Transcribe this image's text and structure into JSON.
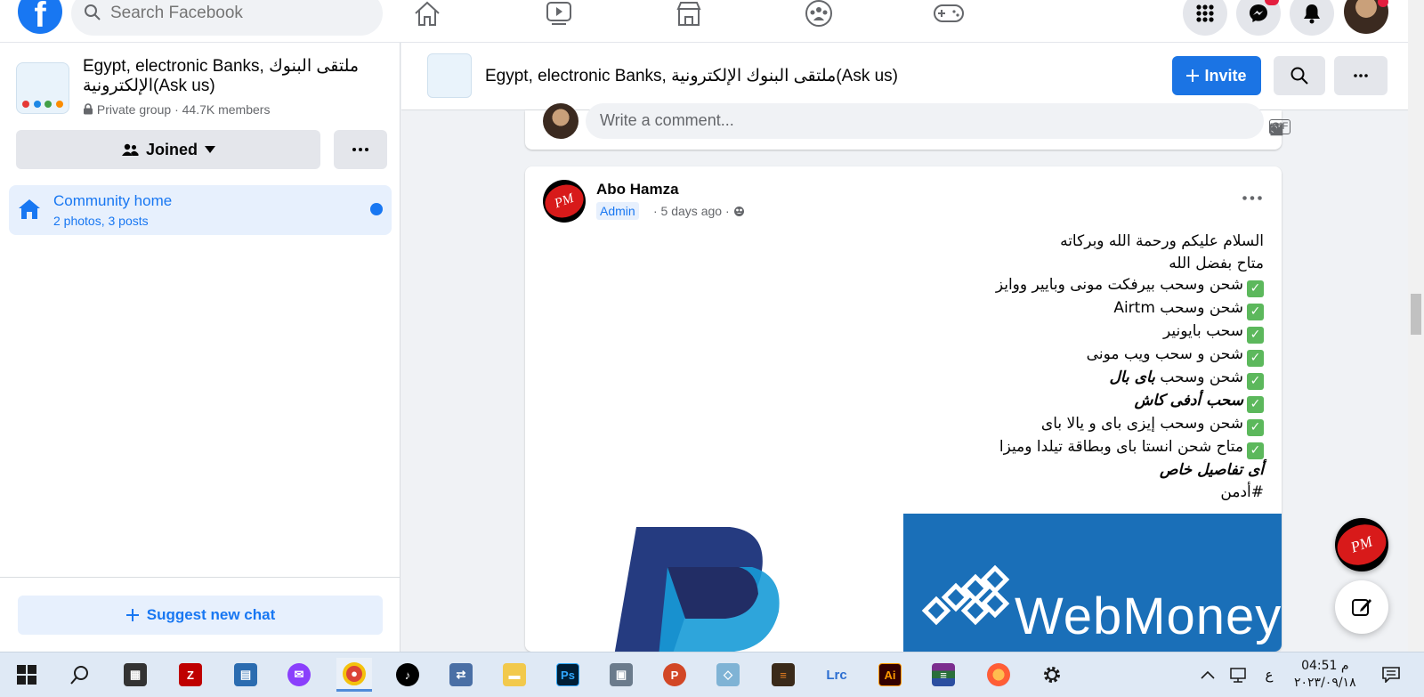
{
  "topbar": {
    "search_placeholder": "Search Facebook",
    "logo_letter": "f"
  },
  "group": {
    "name": "Egypt, electronic Banks, ملتقى البنوك الإلكترونية(Ask us)",
    "privacy": "Private group",
    "members": "44.7K members",
    "joined_label": "Joined",
    "community_home": "Community home",
    "community_sub": "2 photos, 3 posts",
    "suggest_label": "Suggest new chat"
  },
  "header": {
    "title": "Egypt, electronic Banks, ملتقى البنوك الإلكترونية(Ask us)",
    "invite_label": "Invite"
  },
  "comment": {
    "placeholder": "Write a comment..."
  },
  "post": {
    "author": "Abo Hamza",
    "role": "Admin",
    "time": "· 5 days ago ·",
    "logo_text": "PM",
    "lines": [
      "السلام عليكم ورحمة الله وبركاته",
      "متاح بفضل الله",
      "شحن وسحب بيرفكت مونى وبايير ووايز",
      "شحن وسحب Airtm",
      "سحب بايونير",
      "شحن و سحب ويب مونى",
      "شحن وسحب",
      "باى بال",
      "سحب أدفى كاش",
      "شحن وسحب إيزى باى و يالا باى",
      "متاح شحن انستا باى وبطاقة تيلدا وميزا",
      "أى تفاصيل خاص",
      "#أدمن"
    ],
    "image_text": "WebMoney",
    "check_glyph": "✓"
  },
  "taskbar": {
    "time": "04:51 م",
    "date": "٢٠٢٣/٠٩/١٨",
    "lang": "ع"
  },
  "colors": {
    "brand": "#1877f2",
    "invite": "#1b74e4",
    "notification": "#e41e3f"
  }
}
